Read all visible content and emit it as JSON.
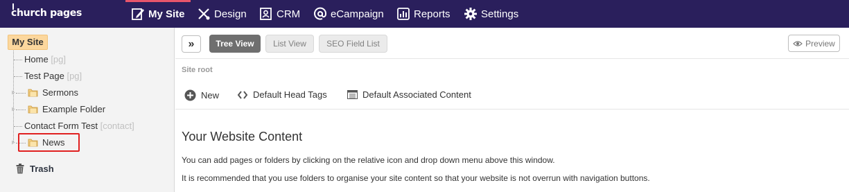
{
  "app": {
    "logo_text": "church pages"
  },
  "nav": {
    "items": [
      {
        "label": "My Site",
        "icon": "edit-page-icon"
      },
      {
        "label": "Design",
        "icon": "design-tools-icon"
      },
      {
        "label": "CRM",
        "icon": "contact-card-icon"
      },
      {
        "label": "eCampaign",
        "icon": "at-sign-icon"
      },
      {
        "label": "Reports",
        "icon": "bar-chart-icon"
      },
      {
        "label": "Settings",
        "icon": "gear-icon"
      }
    ],
    "active": "My Site"
  },
  "sidebar": {
    "root_label": "My Site",
    "tree": [
      {
        "label": "Home",
        "tag": "[pg]",
        "type": "page"
      },
      {
        "label": "Test Page",
        "tag": "[pg]",
        "type": "page"
      },
      {
        "label": "Sermons",
        "tag": "",
        "type": "folder"
      },
      {
        "label": "Example Folder",
        "tag": "",
        "type": "folder"
      },
      {
        "label": "Contact Form Test",
        "tag": "[contact]",
        "type": "page"
      },
      {
        "label": "News",
        "tag": "",
        "type": "folder"
      }
    ],
    "trash_label": "Trash"
  },
  "toolbar": {
    "expand_symbol": "»",
    "tabs": [
      {
        "label": "Tree View",
        "active": true
      },
      {
        "label": "List View",
        "active": false
      },
      {
        "label": "SEO Field List",
        "active": false
      }
    ],
    "preview_label": "Preview"
  },
  "main": {
    "breadcrumb": "Site root",
    "actions": [
      {
        "label": "New",
        "icon": "plus-circle-icon"
      },
      {
        "label": "Default Head Tags",
        "icon": "code-brackets-icon"
      },
      {
        "label": "Default Associated Content",
        "icon": "content-block-icon"
      }
    ],
    "title": "Your Website Content",
    "paragraphs": [
      "You can add pages or folders by clicking on the relative icon and drop down menu above this window.",
      "It is recommended that you use folders to organise your site content so that your website is not overrun with navigation buttons."
    ]
  },
  "colors": {
    "topbar": "#2a1f5c",
    "active_accent": "#e8556b",
    "root_badge": "#fcd79d",
    "highlight": "#e02020"
  }
}
